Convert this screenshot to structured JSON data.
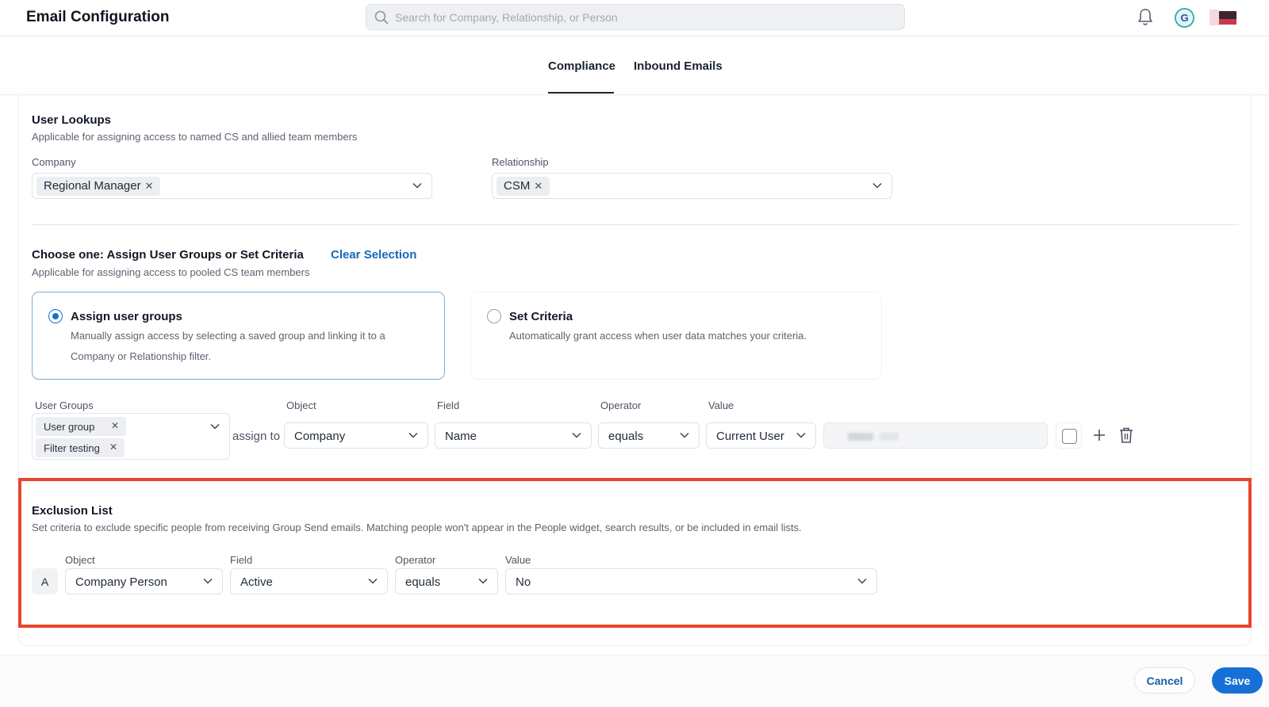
{
  "header": {
    "title": "Email Configuration",
    "search_placeholder": "Search for Company, Relationship, or Person",
    "avatar_letter": "G"
  },
  "tabs": [
    {
      "label": "Compliance",
      "active": true
    },
    {
      "label": "Inbound Emails",
      "active": false
    }
  ],
  "user_lookups": {
    "title": "User Lookups",
    "description": "Applicable for assigning access to named CS and allied team members",
    "company_label": "Company",
    "company_chip": "Regional Manager",
    "relationship_label": "Relationship",
    "relationship_chip": "CSM"
  },
  "assign": {
    "title": "Choose one: Assign User Groups or Set Criteria",
    "clear_selection": "Clear Selection",
    "description": "Applicable for assigning access to pooled CS team members",
    "option_groups": {
      "title": "Assign user groups",
      "desc_line1": "Manually assign access by selecting a saved group and linking it to a",
      "desc_line2": "Company or Relationship filter.",
      "selected": true
    },
    "option_criteria": {
      "title": "Set Criteria",
      "description": "Automatically grant access when user data matches your criteria.",
      "selected": false
    },
    "user_groups_label": "User Groups",
    "user_groups": [
      "User group",
      "Filter testing"
    ],
    "assign_to": "assign to",
    "object_label": "Object",
    "object_value": "Company",
    "field_label": "Field",
    "field_value": "Name",
    "operator_label": "Operator",
    "operator_value": "equals",
    "value_label": "Value",
    "value_value": "Current User"
  },
  "exclusion": {
    "title": "Exclusion List",
    "description": "Set criteria to exclude specific people from receiving Group Send emails. Matching people won't appear in the People widget, search results, or be included in email lists.",
    "row_letter": "A",
    "object_label": "Object",
    "object_value": "Company Person",
    "field_label": "Field",
    "field_value": "Active",
    "operator_label": "Operator",
    "operator_value": "equals",
    "value_label": "Value",
    "value_value": "No"
  },
  "footer": {
    "cancel": "Cancel",
    "save": "Save"
  },
  "colors": {
    "accent": "#1670d6",
    "link": "#1668b8",
    "highlight_border": "#e8452c"
  }
}
